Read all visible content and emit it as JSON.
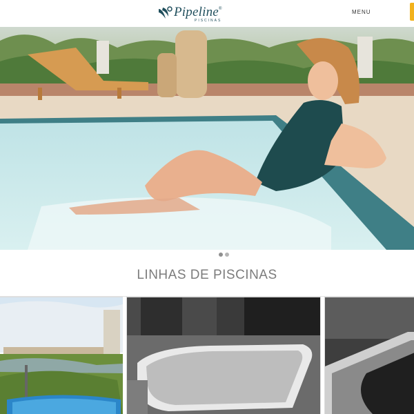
{
  "header": {
    "logo_text": "Pipeline",
    "logo_subtext": "PISCINAS",
    "logo_reg": "®",
    "menu_label": "MENU",
    "accent_color": "#f2b21c",
    "brand_color": "#1f4e5c"
  },
  "hero": {
    "slides": [
      {
        "image": "woman-in-pool-photo",
        "active": true
      },
      {
        "image": "slide-2",
        "active": false
      }
    ]
  },
  "section": {
    "title": "LINHAS DE PISCINAS"
  },
  "cards": [
    {
      "image": "blue-pool-lawn-photo"
    },
    {
      "image": "bw-pool-deck-photo"
    },
    {
      "image": "bw-pool-edge-photo"
    }
  ]
}
